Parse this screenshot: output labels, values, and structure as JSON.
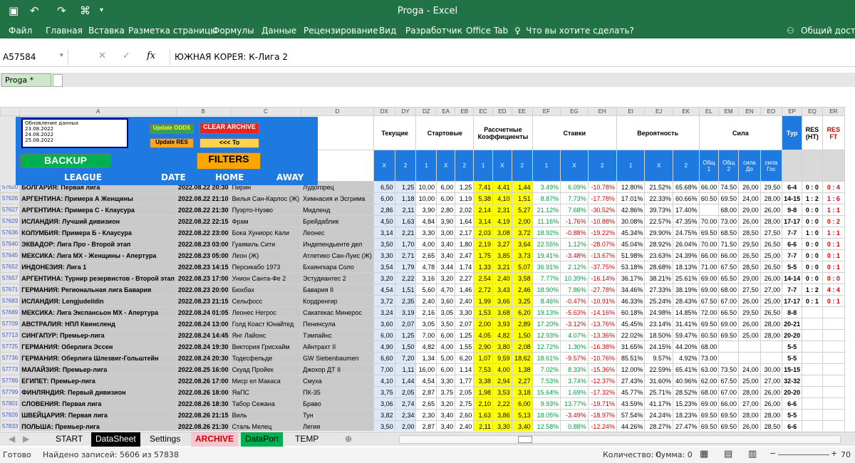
{
  "window": {
    "title": "Proga - Excel",
    "user": "Общий доступ"
  },
  "ribbon": {
    "tabs": [
      "Файл",
      "Главная",
      "Вставка",
      "Разметка страницы",
      "Формулы",
      "Данные",
      "Рецензирование",
      "Вид",
      "Разработчик",
      "Office Tab"
    ],
    "tell_me": "Что вы хотите сделать?"
  },
  "formula_bar": {
    "cell": "A57584",
    "formula": "ЮЖНАЯ КОРЕЯ: К-Лига 2",
    "fx": "fx"
  },
  "workbook_tab": "Proga *",
  "columns": [
    "A",
    "B",
    "C",
    "D",
    "DX",
    "DY",
    "DZ",
    "EA",
    "EB",
    "EC",
    "ED",
    "EE",
    "EF",
    "EG",
    "EH",
    "EI",
    "EJ",
    "EK",
    "EL",
    "EM",
    "EN",
    "EO",
    "EP",
    "EQ",
    "ER"
  ],
  "panel": {
    "update_list_title": "Обновление данных",
    "update_list": [
      "23.08.2022",
      "24.08.2022",
      "25.08.2022"
    ],
    "update_odds": "Update ODDS",
    "clear_archive": "CLEAR ARCHIVE",
    "update_res": "Update RES",
    "to": "<<< To",
    "backup": "BACKUP",
    "filters": "FILTERS"
  },
  "groups": {
    "current": "Текущие",
    "start": "Стартовые",
    "calc": "Рассчетные Коэффициенты",
    "bets": "Ставки",
    "prob": "Вероятность",
    "power": "Сила",
    "tour": "Тур",
    "res_ht": "RES (HT)",
    "res_ft": "RES FT"
  },
  "headers": {
    "league": "LEAGUE",
    "date": "DATE",
    "home": "HOME",
    "away": "AWAY",
    "o1": "1",
    "ox": "X",
    "o2": "2",
    "p1": "Общ 1",
    "p2": "Общ 2",
    "ph": "сила До",
    "pa": "сила Гос"
  },
  "rows": [
    {
      "n": "57620",
      "league": "БОЛГАРИЯ: Первая лига",
      "date": "2022.08.22 20:30",
      "home": "Пирин",
      "away": "Лудогорец",
      "v": [
        "6,50",
        "1,25",
        "10,00",
        "6,00",
        "1,25",
        "7,41",
        "4,41",
        "1,44",
        "3.49%",
        "6.09%",
        "-10.78%",
        "12.80%",
        "21.52%",
        "65.68%",
        "66.00",
        "74.50",
        "26,00",
        "29,50",
        "6-4",
        "0 : 0",
        "0 : 4"
      ]
    },
    {
      "n": "57626",
      "league": "АРГЕНТИНА: Примера А Женщины",
      "date": "2022.08.22 21:10",
      "home": "Вилья Сан-Карлос (Ж)",
      "away": "Химнасия и Эсгрима",
      "v": [
        "6,00",
        "1,18",
        "10,00",
        "6,00",
        "1,19",
        "5,38",
        "4,10",
        "1,51",
        "8.87%",
        "7.73%",
        "-17.78%",
        "17.01%",
        "22.33%",
        "60.66%",
        "60.50",
        "69.50",
        "24,00",
        "28,00",
        "14-15",
        "1 : 2",
        "1 : 6"
      ]
    },
    {
      "n": "57627",
      "league": "АРГЕНТИНА: Примера С - Клаусура",
      "date": "2022.08.22 21:30",
      "home": "Пуэрто-Нуэво",
      "away": "Мидленд",
      "v": [
        "2,86",
        "2,11",
        "3,90",
        "2,80",
        "2,02",
        "2,14",
        "2,31",
        "5,27",
        "21.12%",
        "7.68%",
        "-30.52%",
        "42.86%",
        "39.73%",
        "17.40%",
        "",
        "68.00",
        "29,00",
        "26,00",
        "9-8",
        "0 : 0",
        "1 : 1"
      ]
    },
    {
      "n": "57629",
      "league": "ИСЛАНДИЯ: Лучший дивизион",
      "date": "2022.08.22 22:15",
      "home": "Фрам",
      "away": "Брейдаблик",
      "v": [
        "4,50",
        "1,63",
        "4,84",
        "3,90",
        "1,64",
        "3,14",
        "4,19",
        "2,00",
        "11.16%",
        "-1.76%",
        "-10.88%",
        "30.08%",
        "22.57%",
        "47.35%",
        "70.00",
        "73.00",
        "26,00",
        "28,00",
        "17-17",
        "0 : 0",
        "0 : 2"
      ]
    },
    {
      "n": "57636",
      "league": "КОЛУМБИЯ: Примера Б - Клаусура",
      "date": "2022.08.22 23:00",
      "home": "Бока Хуниорс Кали",
      "away": "Леонес",
      "v": [
        "3,14",
        "2,21",
        "3,30",
        "3,00",
        "2,17",
        "2,03",
        "3,08",
        "3,72",
        "18.92%",
        "-0.88%",
        "-19.22%",
        "45.34%",
        "29.90%",
        "24.75%",
        "69.50",
        "68.50",
        "28,50",
        "27,50",
        "7-7",
        "1 : 0",
        "1 : 1"
      ]
    },
    {
      "n": "57640",
      "league": "ЭКВАДОР: Лига Про - Второй этап",
      "date": "2022.08.23 03:00",
      "home": "Гуаякиль Сити",
      "away": "Индепендьенте дел",
      "v": [
        "3,50",
        "1,70",
        "4,00",
        "3,40",
        "1,80",
        "2,19",
        "3,27",
        "3,64",
        "22.55%",
        "1.12%",
        "-28.07%",
        "45.04%",
        "28.92%",
        "26.04%",
        "70.00",
        "71.50",
        "29,50",
        "26,50",
        "6-6",
        "0 : 0",
        "0 : 1"
      ]
    },
    {
      "n": "57645",
      "league": "МЕКСИКА: Лига MX - Женщины - Апертура",
      "date": "2022.08.23 05:00",
      "home": "Леон (Ж)",
      "away": "Атлетико Сан-Луис (Ж)",
      "v": [
        "3,30",
        "2,71",
        "2,65",
        "3,40",
        "2,47",
        "1,75",
        "3,85",
        "3,73",
        "19.41%",
        "-3.48%",
        "-13.67%",
        "51.98%",
        "23.63%",
        "24.39%",
        "66.00",
        "66.00",
        "26,50",
        "25,00",
        "7-7",
        "0 : 0",
        "0 : 1"
      ]
    },
    {
      "n": "57652",
      "league": "ИНДОНЕЗИЯ: Лига 1",
      "date": "2022.08.23 14:15",
      "home": "Персикабо 1973",
      "away": "Бхаянгкара Соло",
      "v": [
        "3,54",
        "1,79",
        "4,78",
        "3,44",
        "1,74",
        "1,33",
        "3,21",
        "5,07",
        "36.91%",
        "2.12%",
        "-37.75%",
        "53.18%",
        "28.68%",
        "18.13%",
        "71.00",
        "67.50",
        "28,50",
        "26,50",
        "5-5",
        "0 : 0",
        "0 : 1"
      ]
    },
    {
      "n": "57657",
      "league": "АРГЕНТИНА: Турнир резервистов - Второй этап",
      "date": "2022.08.23 17:00",
      "home": "Унион Санта-Фе 2",
      "away": "Эстудиантес 2",
      "v": [
        "3,20",
        "2,22",
        "3,16",
        "3,20",
        "2,27",
        "2,54",
        "2,40",
        "3,58",
        "7.77%",
        "10.39%",
        "-16.14%",
        "36.17%",
        "38.21%",
        "25.61%",
        "69.00",
        "65.50",
        "29,00",
        "26,00",
        "14-14",
        "0 : 0",
        "0 : 0"
      ]
    },
    {
      "n": "57671",
      "league": "ГЕРМАНИЯ: Региональная лига Бавария",
      "date": "2022.08.23 20:00",
      "home": "Бюхбах",
      "away": "Бавария II",
      "v": [
        "4,54",
        "1,51",
        "5,60",
        "4,70",
        "1,46",
        "2,72",
        "3,43",
        "2,46",
        "18.90%",
        "7.86%",
        "-27.78%",
        "34.46%",
        "27.33%",
        "38.19%",
        "69.00",
        "68.00",
        "27,50",
        "27,00",
        "7-7",
        "1 : 2",
        "4 : 4"
      ]
    },
    {
      "n": "57683",
      "league": "ИСЛАНДИЯ: Lengjudeildin",
      "date": "2022.08.23 21:15",
      "home": "Сельфосс",
      "away": "Кордренгир",
      "v": [
        "3,72",
        "2,35",
        "2,40",
        "3,60",
        "2,40",
        "1,99",
        "3,66",
        "3,25",
        "8.46%",
        "-0.47%",
        "-10.91%",
        "46.33%",
        "25.24%",
        "28.43%",
        "67.50",
        "67.00",
        "26,00",
        "25,00",
        "17-17",
        "0 : 1",
        "0 : 1"
      ]
    },
    {
      "n": "57689",
      "league": "МЕКСИКА: Лига Экспансьон MX - Апертура",
      "date": "2022.08.24 01:05",
      "home": "Леонес Негрос",
      "away": "Сакатекас Минерос",
      "v": [
        "3,24",
        "3,19",
        "2,16",
        "3,05",
        "3,30",
        "1,53",
        "3,68",
        "6,20",
        "19.13%",
        "-5.63%",
        "-14.16%",
        "60.18%",
        "24.98%",
        "14.85%",
        "72.00",
        "66.50",
        "29,50",
        "26,50",
        "8-8",
        "",
        ""
      ]
    },
    {
      "n": "57709",
      "league": "АВСТРАЛИЯ: НПЛ Квинсленд",
      "date": "2022.08.24 13:00",
      "home": "Голд Коаст Юнайтед",
      "away": "Пенинсула",
      "v": [
        "3,60",
        "2,07",
        "3,05",
        "3,50",
        "2,07",
        "2,00",
        "3,93",
        "2,89",
        "17.20%",
        "-3.12%",
        "-13.76%",
        "45.45%",
        "23.14%",
        "31.41%",
        "69.50",
        "69.00",
        "26,00",
        "28,00",
        "20-21",
        "",
        ""
      ]
    },
    {
      "n": "57713",
      "league": "СИНГАПУР: Премьер-лига",
      "date": "2022.08.24 14:45",
      "home": "Янг Лайонс",
      "away": "Тэмпайнс",
      "v": [
        "6,00",
        "1,25",
        "7,00",
        "6,00",
        "1,25",
        "4,05",
        "4,82",
        "1,50",
        "12.93%",
        "4.07%",
        "-13.36%",
        "22.02%",
        "18.50%",
        "59.47%",
        "60.50",
        "69.50",
        "25,00",
        "28,00",
        "20-20",
        "",
        ""
      ]
    },
    {
      "n": "57725",
      "league": "ГЕРМАНИЯ: Оберлига Эссен",
      "date": "2022.08.24 19:30",
      "home": "Виктория Грисхайм",
      "away": "Айнтрахт II",
      "v": [
        "4,90",
        "1,50",
        "4,82",
        "4,00",
        "1,55",
        "2,90",
        "3,80",
        "2,08",
        "12.72%",
        "1.30%",
        "-16.38%",
        "31.65%",
        "24.15%",
        "44.20%",
        "68.00",
        "",
        "",
        "",
        "5-5",
        "",
        ""
      ]
    },
    {
      "n": "57736",
      "league": "ГЕРМАНИЯ: Оберлига Шлезвиг-Гольштейн",
      "date": "2022.08.24 20:30",
      "home": "Тодесфельде",
      "away": "GW Siebenbaumen",
      "v": [
        "6,60",
        "7,20",
        "1,34",
        "5,00",
        "6,20",
        "1,07",
        "9,59",
        "18,62",
        "18.61%",
        "-9.57%",
        "-10.76%",
        "85.51%",
        "9.57%",
        "4.92%",
        "73.00",
        "",
        "",
        "",
        "5-5",
        "",
        ""
      ]
    },
    {
      "n": "57773",
      "league": "МАЛАЙЗИЯ: Премьер-лига",
      "date": "2022.08.25 16:00",
      "home": "Скуад Пройек",
      "away": "Джохор ДТ II",
      "v": [
        "7,00",
        "1,11",
        "16,00",
        "6,00",
        "1,14",
        "7,53",
        "4,00",
        "1,38",
        "7.02%",
        "8.33%",
        "-15.36%",
        "12.00%",
        "22.59%",
        "65.41%",
        "63.00",
        "73.50",
        "24,00",
        "30,00",
        "15-15",
        "",
        ""
      ]
    },
    {
      "n": "57789",
      "league": "ЕГИПЕТ: Премьер-лига",
      "date": "2022.08.26 17:00",
      "home": "Миср ел Макаса",
      "away": "Смуха",
      "v": [
        "4,10",
        "1,44",
        "4,54",
        "3,30",
        "1,77",
        "3,38",
        "2,94",
        "2,27",
        "7.53%",
        "3.74%",
        "-12.37%",
        "27.43%",
        "31.60%",
        "40.96%",
        "62.00",
        "67.50",
        "25,00",
        "27,00",
        "32-32",
        "",
        ""
      ]
    },
    {
      "n": "57799",
      "league": "ФИНЛЯНДИЯ: Первый дивизион",
      "date": "2022.08.26 18:00",
      "home": "ЯаПС",
      "away": "ПК-35",
      "v": [
        "3,75",
        "2,05",
        "2,87",
        "3,75",
        "2,05",
        "1,98",
        "3,53",
        "3,18",
        "15.64%",
        "1.69%",
        "-17.32%",
        "45.77%",
        "25.71%",
        "28.52%",
        "68.00",
        "67.00",
        "28,00",
        "26,00",
        "20-20",
        "",
        ""
      ]
    },
    {
      "n": "57801",
      "league": "СЛОВЕНИЯ: Первая лига",
      "date": "2022.08.26 18:30",
      "home": "Табор Сежана",
      "away": "Браво",
      "v": [
        "3,06",
        "2,74",
        "2,65",
        "3,20",
        "2,75",
        "2,10",
        "2,22",
        "6,00",
        "9.93%",
        "13.77%",
        "-19.71%",
        "43.59%",
        "41.17%",
        "15.23%",
        "69.00",
        "66.00",
        "27,00",
        "26,00",
        "6-6",
        "",
        ""
      ]
    },
    {
      "n": "57826",
      "league": "ШВЕЙЦАРИЯ: Первая лига",
      "date": "2022.08.26 21:15",
      "home": "Виль",
      "away": "Тун",
      "v": [
        "3,82",
        "2,34",
        "2,30",
        "3,40",
        "2,60",
        "1,63",
        "3,86",
        "5,13",
        "18.05%",
        "-3.49%",
        "-18.97%",
        "57.54%",
        "24.24%",
        "18.23%",
        "69.50",
        "69.50",
        "28,00",
        "28,00",
        "5-5",
        "",
        ""
      ]
    },
    {
      "n": "57833",
      "league": "ПОЛЬША: Премьер-лига",
      "date": "2022.08.26 21:30",
      "home": "Сталь Мелец",
      "away": "Легия",
      "v": [
        "3,50",
        "2,00",
        "2,87",
        "3,40",
        "2,40",
        "2,11",
        "3,30",
        "3,40",
        "12.58%",
        "0.88%",
        "-12.24%",
        "44.26%",
        "28.27%",
        "27.47%",
        "69.50",
        "69.50",
        "26,00",
        "28,50",
        "6-6",
        "",
        ""
      ]
    }
  ],
  "sheets": [
    "START",
    "DataSheet",
    "Settings",
    "ARCHIVE",
    "DataPort",
    "TEMP"
  ],
  "status": {
    "ready": "Готово",
    "found": "Найдено записей: 5606 из 57838",
    "count": "Количество: 0",
    "sum": "Сумма: 0",
    "zoom": "70"
  }
}
